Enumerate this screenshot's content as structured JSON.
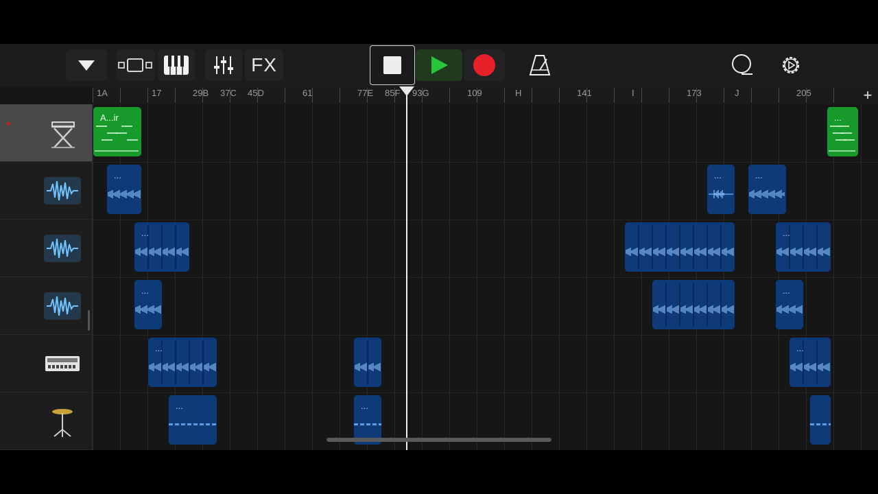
{
  "toolbar": {
    "fx_label": "FX",
    "play_color": "#28c53a",
    "record_color": "#e8202a"
  },
  "ruler": {
    "labels": [
      {
        "text": "1A",
        "bar": 1
      },
      {
        "text": "17",
        "bar": 17
      },
      {
        "text": "29B",
        "bar": 29
      },
      {
        "text": "37C",
        "bar": 37
      },
      {
        "text": "45D",
        "bar": 45
      },
      {
        "text": "61",
        "bar": 61
      },
      {
        "text": "77E",
        "bar": 77
      },
      {
        "text": "85F",
        "bar": 85
      },
      {
        "text": "93G",
        "bar": 93
      },
      {
        "text": "109",
        "bar": 109
      },
      {
        "text": "H",
        "bar": 123
      },
      {
        "text": "141",
        "bar": 141
      },
      {
        "text": "I",
        "bar": 157
      },
      {
        "text": "173",
        "bar": 173
      },
      {
        "text": "J",
        "bar": 187
      },
      {
        "text": "205",
        "bar": 205
      }
    ],
    "add_label": "+",
    "playhead_bar": 92.5
  },
  "tracks": [
    {
      "icon": "keyboard-stand-icon",
      "selected": true,
      "recording": true,
      "regions": [
        {
          "start": 1,
          "end": 15,
          "color": "green",
          "name": "A...ir",
          "style": "midi"
        },
        {
          "start": 215,
          "end": 224,
          "color": "green",
          "name": "...",
          "style": "midi"
        }
      ]
    },
    {
      "icon": "audio-waveform-icon",
      "selected": false,
      "regions": [
        {
          "start": 5,
          "end": 15,
          "color": "blue",
          "name": "...",
          "style": "audio"
        },
        {
          "start": 180,
          "end": 188,
          "color": "blue",
          "name": "...",
          "style": "audio-sparse"
        },
        {
          "start": 192,
          "end": 203,
          "color": "blue",
          "name": "...",
          "style": "audio"
        }
      ]
    },
    {
      "icon": "audio-waveform-icon",
      "selected": false,
      "regions": [
        {
          "start": 13,
          "end": 29,
          "color": "blue",
          "name": "...",
          "style": "audio-seg"
        },
        {
          "start": 156,
          "end": 188,
          "color": "blue",
          "name": "",
          "style": "audio-seg"
        },
        {
          "start": 200,
          "end": 216,
          "color": "blue",
          "name": "...",
          "style": "audio-seg"
        }
      ]
    },
    {
      "icon": "audio-waveform-icon",
      "selected": false,
      "regions": [
        {
          "start": 13,
          "end": 21,
          "color": "blue",
          "name": "...",
          "style": "audio"
        },
        {
          "start": 164,
          "end": 188,
          "color": "blue",
          "name": "",
          "style": "audio-seg"
        },
        {
          "start": 200,
          "end": 208,
          "color": "blue",
          "name": "...",
          "style": "audio"
        }
      ]
    },
    {
      "icon": "drum-machine-icon",
      "selected": false,
      "regions": [
        {
          "start": 17,
          "end": 37,
          "color": "blue",
          "name": "...",
          "style": "audio-seg"
        },
        {
          "start": 77,
          "end": 85,
          "color": "blue",
          "name": "",
          "style": "audio-seg"
        },
        {
          "start": 204,
          "end": 216,
          "color": "blue",
          "name": "...",
          "style": "audio-seg"
        }
      ]
    },
    {
      "icon": "cymbal-stand-icon",
      "selected": false,
      "regions": [
        {
          "start": 23,
          "end": 37,
          "color": "blue",
          "name": "...",
          "style": "dashes"
        },
        {
          "start": 77,
          "end": 85,
          "color": "blue",
          "name": "...",
          "style": "dashes"
        },
        {
          "start": 210,
          "end": 216,
          "color": "blue",
          "name": "",
          "style": "dashes"
        }
      ]
    }
  ]
}
